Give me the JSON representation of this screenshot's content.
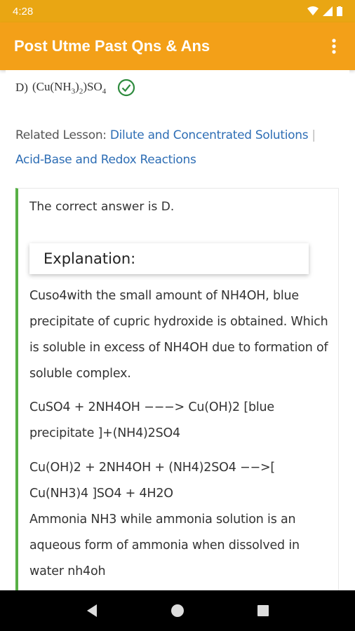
{
  "status_bar": {
    "time": "4:28"
  },
  "app_bar": {
    "title": "Post Utme Past Qns & Ans",
    "menu_icon": "more-vert-icon"
  },
  "question": {
    "option_label": "D)",
    "option_text_parts": [
      "(Cu(NH",
      "3",
      ")",
      "2",
      ")SO",
      "4"
    ],
    "correct_icon": "check-circle-icon"
  },
  "related": {
    "label": "Related Lesson:",
    "lessons": [
      "Dilute and Concentrated Solutions",
      "Acid-Base and Redox Reactions"
    ],
    "separator": "|"
  },
  "answer": {
    "correct_text": "The correct answer is D.",
    "explanation_title": "Explanation:",
    "paragraphs": [
      "Cuso4with the small amount of NH4OH, blue precipitate of cupric hydroxide is obtained. Which is soluble in excess of NH4OH due to formation of soluble complex.",
      "CuSO4 + 2NH4OH −−−> Cu(OH)2 [blue precipitate ]+(NH4)2SO4",
      "Cu(OH)2 + 2NH4OH + (NH4)2SO4 −−>[ Cu(NH3)4 ]SO4 + 4H2O",
      "Ammonia NH3 while ammonia solution is an aqueous form of ammonia when dissolved in water nh4oh"
    ]
  },
  "colors": {
    "status_bar": "#e9a613",
    "app_bar": "#f3a018",
    "link": "#2e6eb5",
    "accent_green": "#58b046"
  }
}
